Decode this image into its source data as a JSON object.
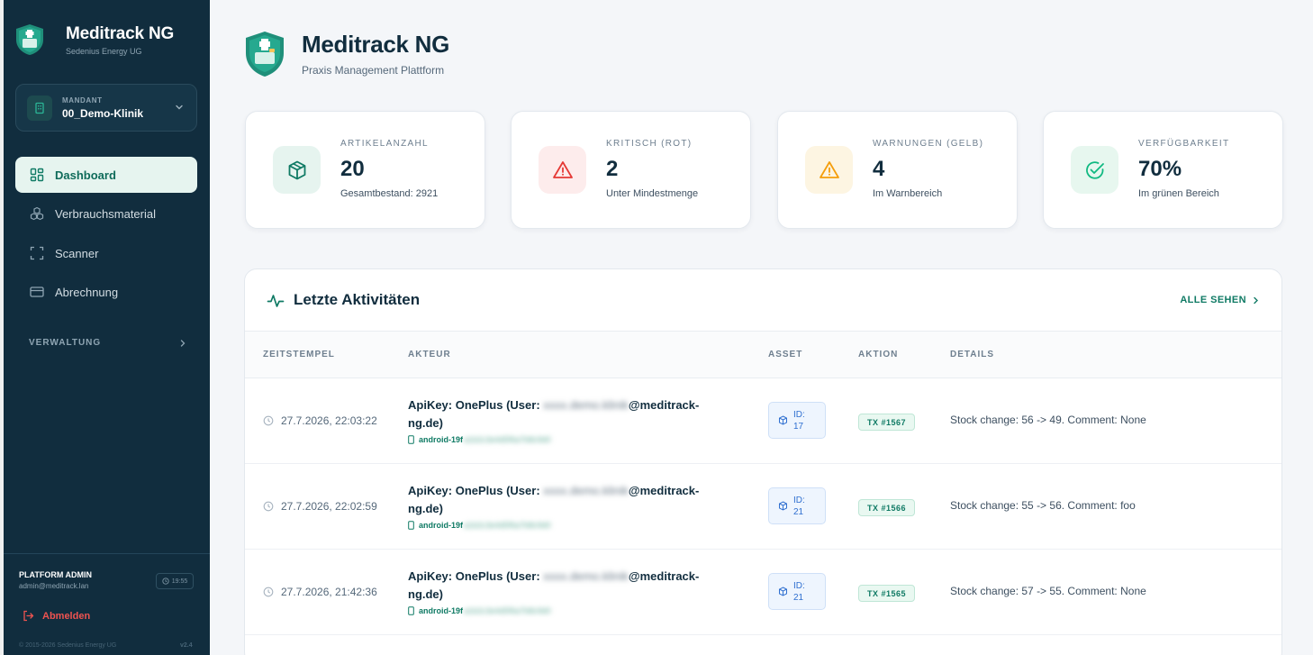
{
  "app": {
    "name": "Meditrack NG",
    "company": "Sedenius Energy UG",
    "subtitle": "Praxis Management Plattform",
    "colors": {
      "sidebar": "#112d3e",
      "accent": "#0f7a64",
      "danger": "#e53935",
      "warning": "#f59e0b"
    }
  },
  "mandant": {
    "label": "MANDANT",
    "value": "00_Demo-Klinik",
    "icon": "building-icon"
  },
  "nav": {
    "items": [
      {
        "label": "Dashboard",
        "icon": "dashboard-grid-icon",
        "active": true
      },
      {
        "label": "Verbrauchsmaterial",
        "icon": "boxes-icon",
        "active": false
      },
      {
        "label": "Scanner",
        "icon": "scan-frame-icon",
        "active": false
      },
      {
        "label": "Abrechnung",
        "icon": "credit-card-icon",
        "active": false
      }
    ],
    "section": "VERWALTUNG"
  },
  "user": {
    "role": "PLATFORM ADMIN",
    "email": "admin@meditrack.lan",
    "time": "19:55",
    "logout": "Abmelden",
    "copyright": "© 2015-2026 Sedenius Energy UG",
    "version": "v2.4"
  },
  "stats": [
    {
      "label": "ARTIKELANZAHL",
      "value": "20",
      "desc": "Gesamtbestand: 2921",
      "icon": "box-icon",
      "color": "#0f7a64",
      "bg": "#e6f4ef"
    },
    {
      "label": "KRITISCH (ROT)",
      "value": "2",
      "desc": "Unter Mindestmenge",
      "icon": "alert-triangle-icon",
      "color": "#e53935",
      "bg": "#fdecec"
    },
    {
      "label": "WARNUNGEN (GELB)",
      "value": "4",
      "desc": "Im Warnbereich",
      "icon": "warning-triangle-icon",
      "color": "#f59e0b",
      "bg": "#fdf5e2"
    },
    {
      "label": "VERFÜGBARKEIT",
      "value": "70%",
      "desc": "Im grünen Bereich",
      "icon": "check-circle-icon",
      "color": "#10b981",
      "bg": "#e7f7ef"
    }
  ],
  "activity": {
    "title": "Letzte Aktivitäten",
    "see_all": "ALLE SEHEN",
    "columns": [
      "ZEITSTEMPEL",
      "AKTEUR",
      "ASSET",
      "AKTION",
      "DETAILS"
    ],
    "rows": [
      {
        "time": "27.7.2026, 22:03:22",
        "actor_prefix": "ApiKey: OnePlus (User:",
        "actor_hidden": "xxxx.demo.klinik",
        "actor_suffix": "@meditrack-",
        "actor_line2": "ng.de)",
        "device_prefix": "android-19f",
        "device_hidden": "a1b2c3e4d5f6a7b8c9d0",
        "asset_id": "ID:",
        "asset_num": "17",
        "tx": "TX #1567",
        "details": "Stock change: 56 -> 49. Comment: None"
      },
      {
        "time": "27.7.2026, 22:02:59",
        "actor_prefix": "ApiKey: OnePlus (User:",
        "actor_hidden": "xxxx.demo.klinik",
        "actor_suffix": "@meditrack-",
        "actor_line2": "ng.de)",
        "device_prefix": "android-19f",
        "device_hidden": "a1b2c3e4d5f6a7b8c9d0",
        "asset_id": "ID:",
        "asset_num": "21",
        "tx": "TX #1566",
        "details": "Stock change: 55 -> 56. Comment: foo"
      },
      {
        "time": "27.7.2026, 21:42:36",
        "actor_prefix": "ApiKey: OnePlus (User:",
        "actor_hidden": "xxxx.demo.klinik",
        "actor_suffix": "@meditrack-",
        "actor_line2": "ng.de)",
        "device_prefix": "android-19f",
        "device_hidden": "a1b2c3e4d5f6a7b8c9d0",
        "asset_id": "ID:",
        "asset_num": "21",
        "tx": "TX #1565",
        "details": "Stock change: 57 -> 55. Comment: None"
      }
    ]
  }
}
